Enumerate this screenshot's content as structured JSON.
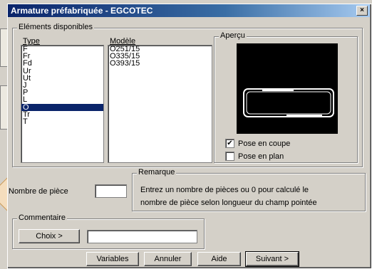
{
  "window": {
    "title": "Armature préfabriquée - EGCOTEC",
    "close_glyph": "×"
  },
  "elements_group": {
    "label": "Eléments disponibles",
    "type_label": "Type",
    "type_items": [
      "F",
      "Fr",
      "Fd",
      "Ur",
      "Ut",
      "J",
      "P",
      "L",
      "O",
      "Tr",
      "T"
    ],
    "type_selected": "O",
    "model_label": "Modèle",
    "model_items": [
      "O251/15",
      "O335/15",
      "O393/15"
    ]
  },
  "preview_group": {
    "label": "Aperçu",
    "pose_coupe_label": "Pose en coupe",
    "pose_coupe_checked": true,
    "pose_plan_label": "Pose en plan",
    "pose_plan_checked": false
  },
  "remarque_group": {
    "label": "Remarque",
    "line1": "Entrez un nombre de pièces ou 0 pour calculé le",
    "line2": "nombre de pièce selon longueur du champ pointée"
  },
  "nombre_piece": {
    "label": "Nombre de pièce",
    "value": ""
  },
  "commentaire_group": {
    "label": "Commentaire",
    "choix_label": "Choix >",
    "value": ""
  },
  "buttons": {
    "variables": "Variables",
    "annuler": "Annuler",
    "aide": "Aide",
    "suivant": "Suivant >"
  }
}
